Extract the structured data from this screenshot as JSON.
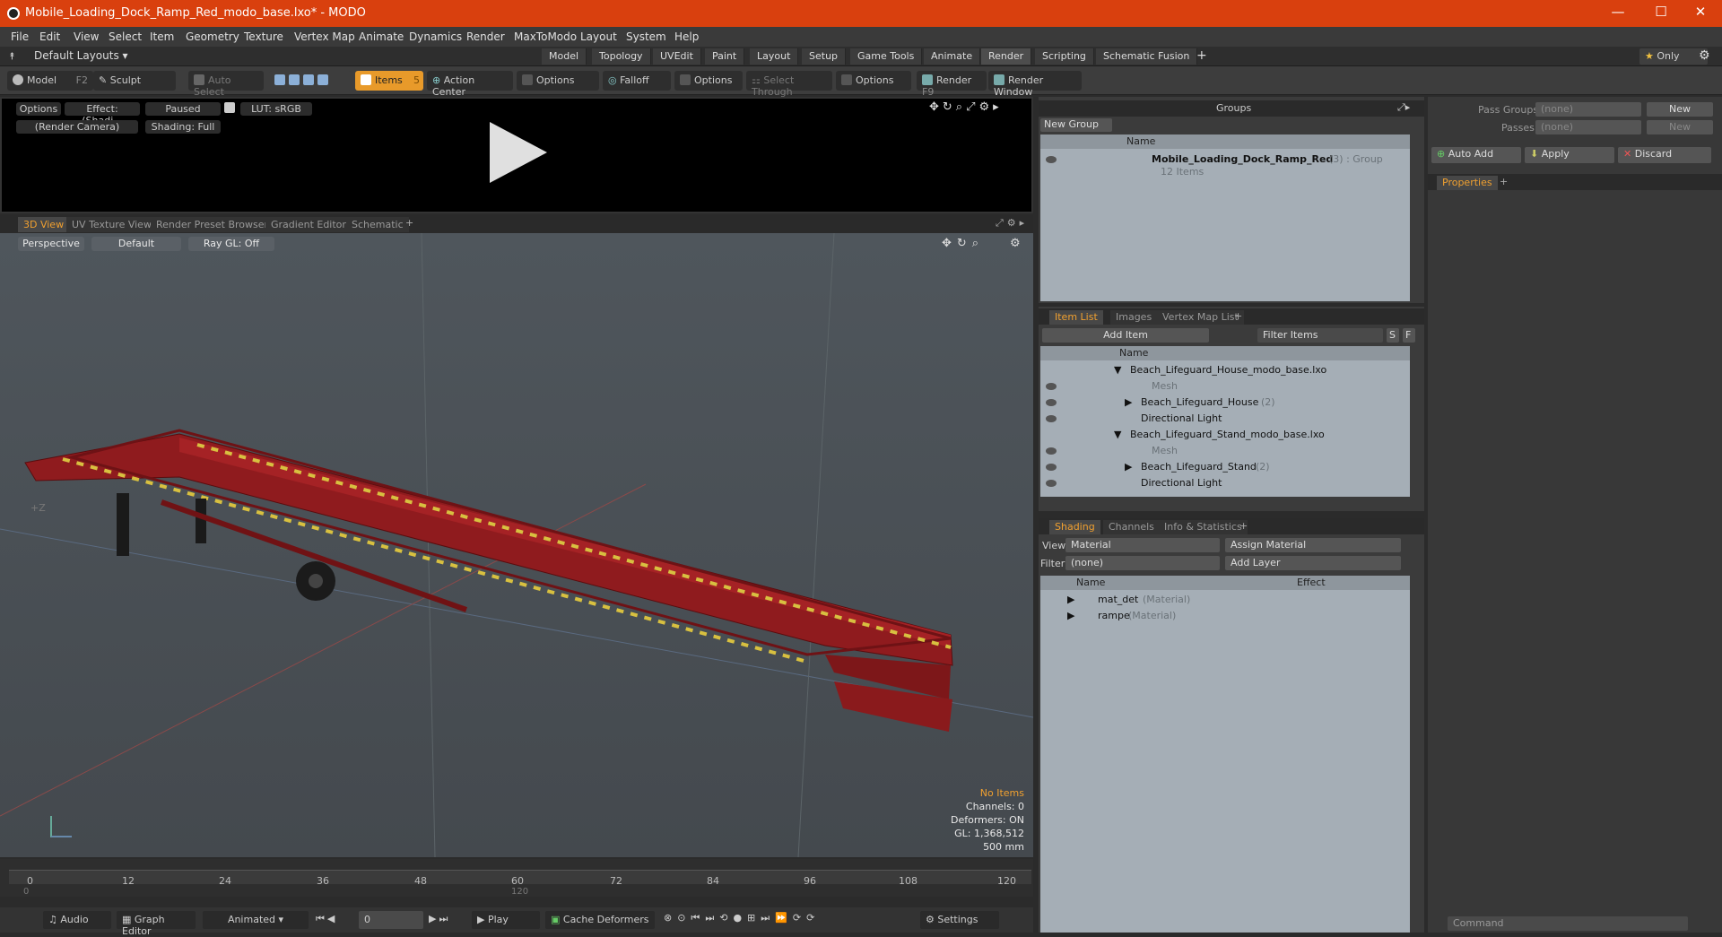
{
  "window": {
    "title": "Mobile_Loading_Dock_Ramp_Red_modo_base.lxo* - MODO",
    "minimize": "—",
    "maximize": "☐",
    "close": "✕"
  },
  "menu": [
    "File",
    "Edit",
    "View",
    "Select",
    "Item",
    "Geometry",
    "Texture",
    "Vertex Map",
    "Animate",
    "Dynamics",
    "Render",
    "MaxToModo",
    "Layout",
    "System",
    "Help"
  ],
  "layouts": {
    "default": "Default Layouts ▾",
    "tabs": [
      "Model",
      "Topology",
      "UVEdit",
      "Paint",
      "Layout",
      "Setup",
      "Game Tools",
      "Animate",
      "Render",
      "Scripting",
      "Schematic Fusion"
    ],
    "add": "+",
    "only": "Only"
  },
  "toolbar": {
    "model": "Model",
    "model_key": "F2",
    "sculpt": "Sculpt",
    "auto_select": "Auto Select",
    "items": "Items",
    "items_key": "5",
    "action_center": "Action Center",
    "options1": "Options",
    "falloff": "Falloff",
    "options2": "Options",
    "select_through": "Select Through",
    "options3": "Options",
    "render": "Render",
    "render_key": "F9",
    "render_window": "Render Window"
  },
  "preview": {
    "options": "Options",
    "effect": "Effect: (Shadi...",
    "paused": "Paused",
    "lut": "LUT: sRGB",
    "camera": "(Render Camera)",
    "shading": "Shading: Full"
  },
  "viewtabs": [
    "3D View",
    "UV Texture View",
    "Render Preset Browser",
    "Gradient Editor",
    "Schematic",
    "+"
  ],
  "viewport": {
    "perspective": "Perspective",
    "default": "Default",
    "raygl": "Ray GL: Off",
    "axis_z": "+Z",
    "stats": {
      "items": "No Items",
      "channels": "Channels: 0",
      "deformers": "Deformers: ON",
      "gl": "GL: 1,368,512",
      "unit": "500 mm"
    }
  },
  "timeline": {
    "ticks": [
      "0",
      "12",
      "24",
      "36",
      "48",
      "60",
      "72",
      "84",
      "96",
      "108",
      "120"
    ],
    "sub": [
      "0",
      "120"
    ]
  },
  "bottom": {
    "audio": "Audio",
    "graph_editor": "Graph Editor",
    "animated": "Animated",
    "frame": "0",
    "play": "Play",
    "cache_deformers": "Cache Deformers",
    "settings": "Settings"
  },
  "groups": {
    "title": "Groups",
    "new_group": "New Group",
    "name_col": "Name",
    "item_name": "Mobile_Loading_Dock_Ramp_Red",
    "item_meta": "(3) : Group",
    "item_count": "12 Items"
  },
  "itemlist": {
    "tabs": [
      "Item List",
      "Images",
      "Vertex Map List",
      "+"
    ],
    "add_item": "Add Item",
    "filter": "Filter Items",
    "s": "S",
    "f": "F",
    "name_col": "Name",
    "rows": [
      {
        "label": "Beach_Lifeguard_House_modo_base.lxo",
        "indent": 0,
        "dim": false,
        "tri": "▼"
      },
      {
        "label": "Mesh",
        "indent": 2,
        "dim": true,
        "tri": ""
      },
      {
        "label": "Beach_Lifeguard_House",
        "suffix": "(2)",
        "indent": 1,
        "dim": false,
        "tri": "▶"
      },
      {
        "label": "Directional Light",
        "indent": 1,
        "dim": false,
        "tri": ""
      },
      {
        "label": "Beach_Lifeguard_Stand_modo_base.lxo",
        "indent": 0,
        "dim": false,
        "tri": "▼"
      },
      {
        "label": "Mesh",
        "indent": 2,
        "dim": true,
        "tri": ""
      },
      {
        "label": "Beach_Lifeguard_Stand",
        "suffix": "(2)",
        "indent": 1,
        "dim": false,
        "tri": "▶"
      },
      {
        "label": "Directional Light",
        "indent": 1,
        "dim": false,
        "tri": ""
      }
    ]
  },
  "shading": {
    "tabs": [
      "Shading",
      "Channels",
      "Info & Statistics",
      "+"
    ],
    "view_label": "View",
    "view_value": "Material",
    "assign": "Assign Material",
    "filter_label": "Filter",
    "filter_value": "(none)",
    "add_layer": "Add Layer",
    "name_col": "Name",
    "effect_col": "Effect",
    "rows": [
      {
        "name": "mat_det",
        "type": "(Material)"
      },
      {
        "name": "rampe",
        "type": "(Material)"
      }
    ]
  },
  "passes": {
    "pass_groups": "Pass Groups",
    "passes": "Passes",
    "none": "(none)",
    "new": "New",
    "auto_add": "Auto Add",
    "apply": "Apply",
    "discard": "Discard",
    "properties": "Properties",
    "plus": "+"
  },
  "command": {
    "placeholder": "Command"
  }
}
